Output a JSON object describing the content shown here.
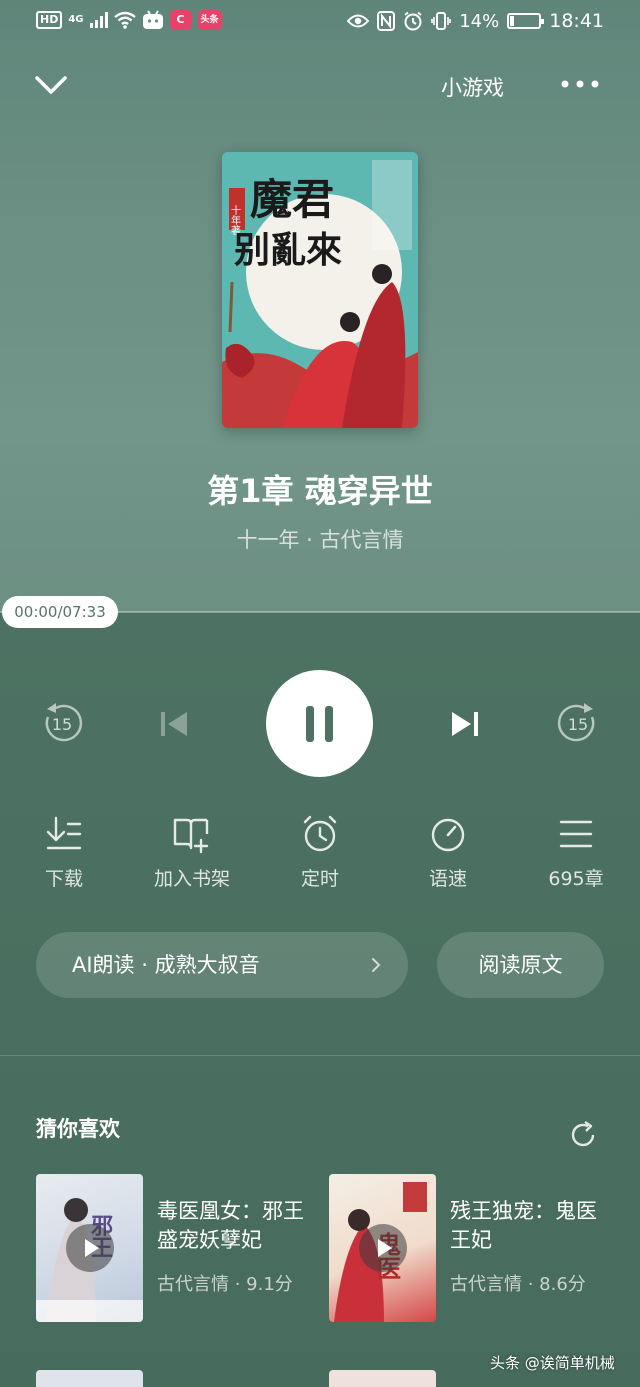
{
  "status_bar": {
    "hd": "HD",
    "network": "4G",
    "app_badge_1": "C",
    "app_badge_2": "头条",
    "battery": "14%",
    "battery_level": 0.14,
    "time": "18:41"
  },
  "nav": {
    "mini_games": "小游戏"
  },
  "cover_art": {
    "title_line1": "魔君",
    "title_line2": "别亂來",
    "author_badge": "十年著"
  },
  "player": {
    "chapter_title": "第1章 魂穿异世",
    "meta": "十一年 · 古代言情",
    "time_display": "00:00/07:33",
    "progress": 0,
    "rewind_seconds": "15",
    "forward_seconds": "15"
  },
  "actions": [
    {
      "label": "下载",
      "icon": "download-icon"
    },
    {
      "label": "加入书架",
      "icon": "add-bookshelf-icon"
    },
    {
      "label": "定时",
      "icon": "alarm-clock-icon"
    },
    {
      "label": "语速",
      "icon": "speed-icon"
    },
    {
      "label": "695章",
      "icon": "chapter-list-icon"
    }
  ],
  "ai_read": {
    "label": "AI朗读 · 成熟大叔音"
  },
  "read_original": {
    "label": "阅读原文"
  },
  "recommendations": {
    "heading": "猜你喜欢",
    "items": [
      {
        "title": "毒医凰女：邪王盛宠妖孽妃",
        "meta": "古代言情 · 9.1分",
        "cover_text": "邪王"
      },
      {
        "title": "残王独宠：鬼医王妃",
        "meta": "古代言情 · 8.6分",
        "cover_text": "鬼医"
      }
    ]
  },
  "watermark": "头条 @诶简单机械",
  "colors": {
    "accent": "#4d7263",
    "top_background": "#6b8f83",
    "bottom_background": "#4a6f60"
  }
}
